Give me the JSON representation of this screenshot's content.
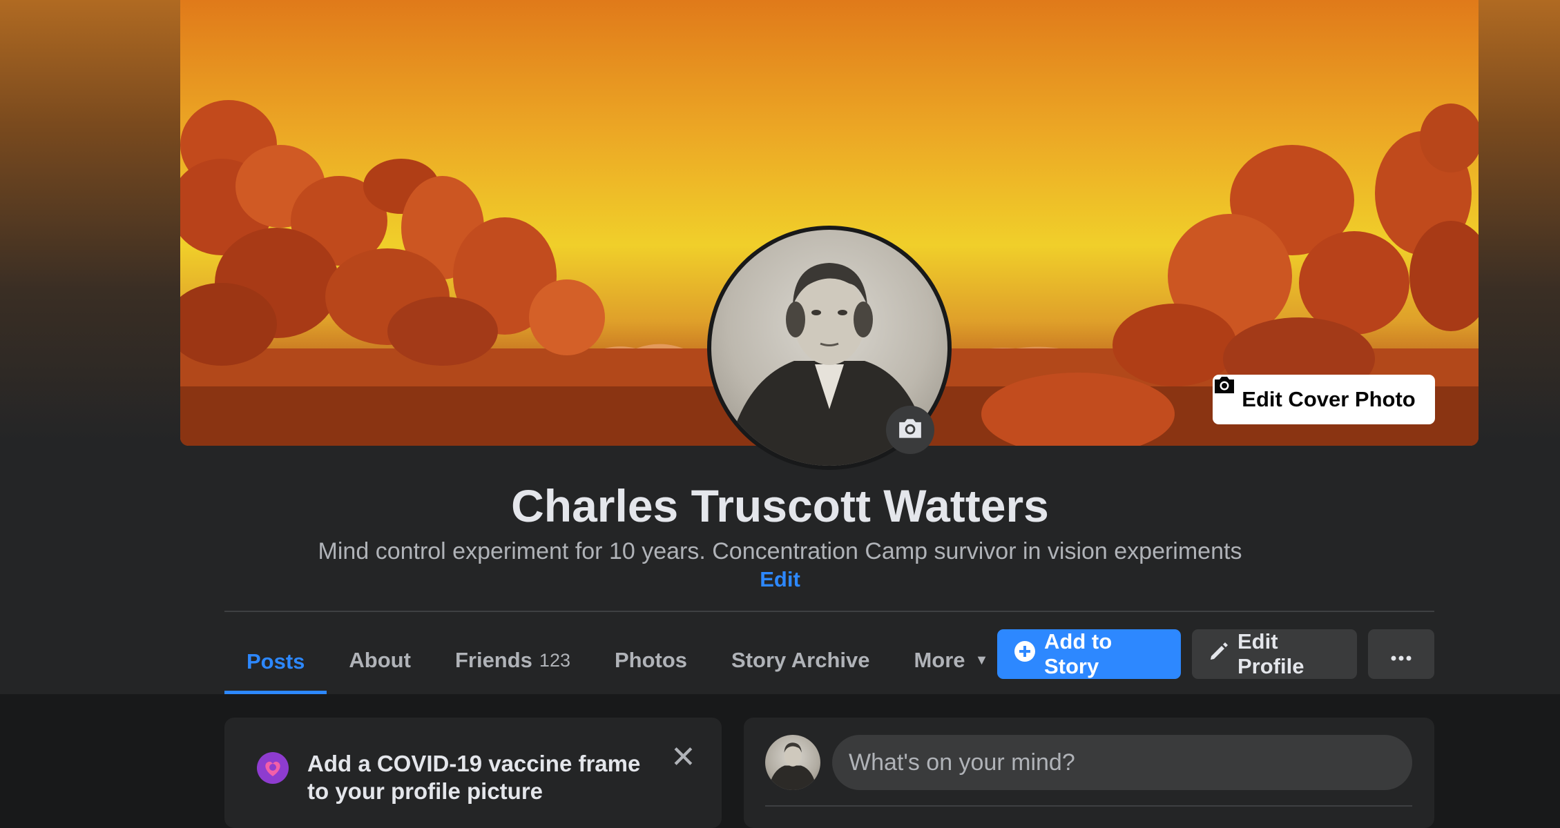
{
  "cover": {
    "edit_cover_label": "Edit Cover Photo",
    "icon": "camera-icon"
  },
  "profile": {
    "name": "Charles Truscott Watters",
    "bio": "Mind control experiment for 10 years. Concentration Camp survivor in vision experiments",
    "bio_edit_label": "Edit",
    "avatar_camera_icon": "camera-icon"
  },
  "tabs": [
    {
      "label": "Posts",
      "active": true
    },
    {
      "label": "About"
    },
    {
      "label": "Friends",
      "count": "123"
    },
    {
      "label": "Photos"
    },
    {
      "label": "Story Archive"
    },
    {
      "label": "More",
      "icon": "caret-down-icon"
    }
  ],
  "actions": {
    "add_to_story": "Add to Story",
    "edit_profile": "Edit Profile",
    "more_icon": "ellipsis-icon"
  },
  "covid_card": {
    "title": "Add a COVID-19 vaccine frame to your profile picture",
    "close_icon": "close-icon"
  },
  "composer": {
    "placeholder": "What's on your mind?"
  },
  "colors": {
    "accent": "#2d88ff",
    "background": "#18191a",
    "surface": "#242526",
    "button_gray": "#3a3b3c"
  }
}
